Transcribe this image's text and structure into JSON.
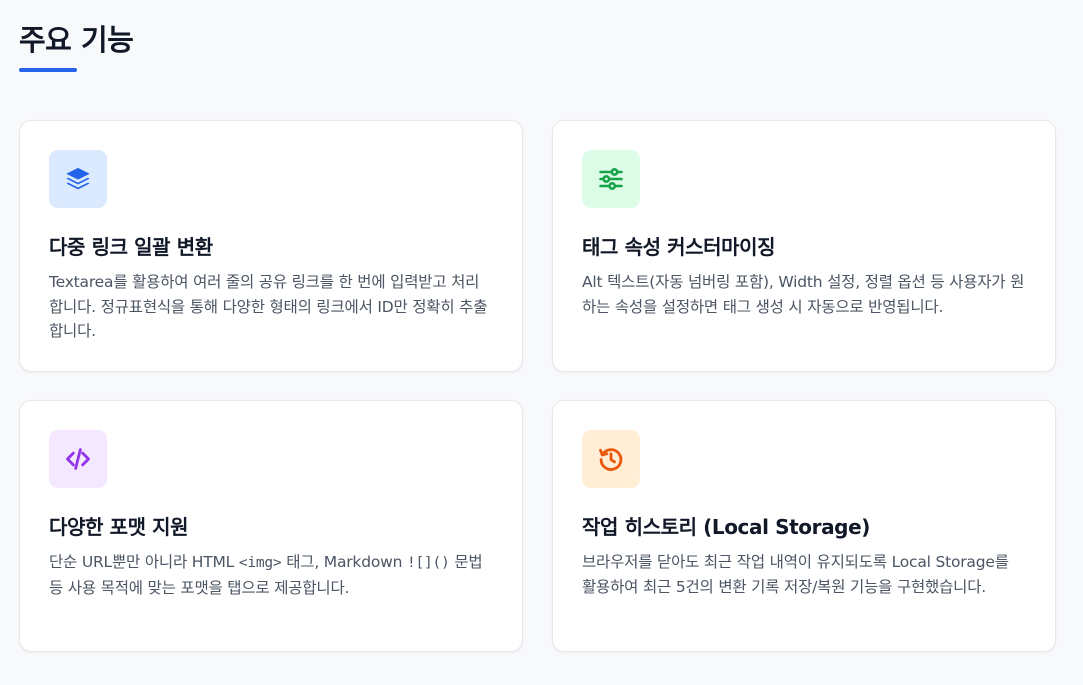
{
  "section": {
    "title": "주요 기능",
    "accent_color": "#2563eb"
  },
  "features": [
    {
      "icon": "layers-icon",
      "icon_bg": "#dbeafe",
      "icon_color": "#2563eb",
      "title": "다중 링크 일괄 변환",
      "description": "Textarea를 활용하여 여러 줄의 공유 링크를 한 번에 입력받고 처리합니다. 정규표현식을 통해 다양한 형태의 링크에서 ID만 정확히 추출합니다."
    },
    {
      "icon": "sliders-icon",
      "icon_bg": "#dcfce7",
      "icon_color": "#16a34a",
      "title": "태그 속성 커스터마이징",
      "description": "Alt 텍스트(자동 넘버링 포함), Width 설정, 정렬 옵션 등 사용자가 원하는 속성을 설정하면 태그 생성 시 자동으로 반영됩니다."
    },
    {
      "icon": "code-icon",
      "icon_bg": "#f3e8ff",
      "icon_color": "#9333ea",
      "title": "다양한 포맷 지원",
      "description_part1": "단순 URL뿐만 아니라 HTML ",
      "description_code1": "<img>",
      "description_part2": " 태그, Markdown ",
      "description_code2": "![]()",
      "description_part3": " 문법 등 사용 목적에 맞는 포맷을 탭으로 제공합니다."
    },
    {
      "icon": "history-icon",
      "icon_bg": "#ffedd5",
      "icon_color": "#ea580c",
      "title": "작업 히스토리 (Local Storage)",
      "description": "브라우저를 닫아도 최근 작업 내역이 유지되도록 Local Storage를 활용하여 최근 5건의 변환 기록 저장/복원 기능을 구현했습니다."
    }
  ]
}
